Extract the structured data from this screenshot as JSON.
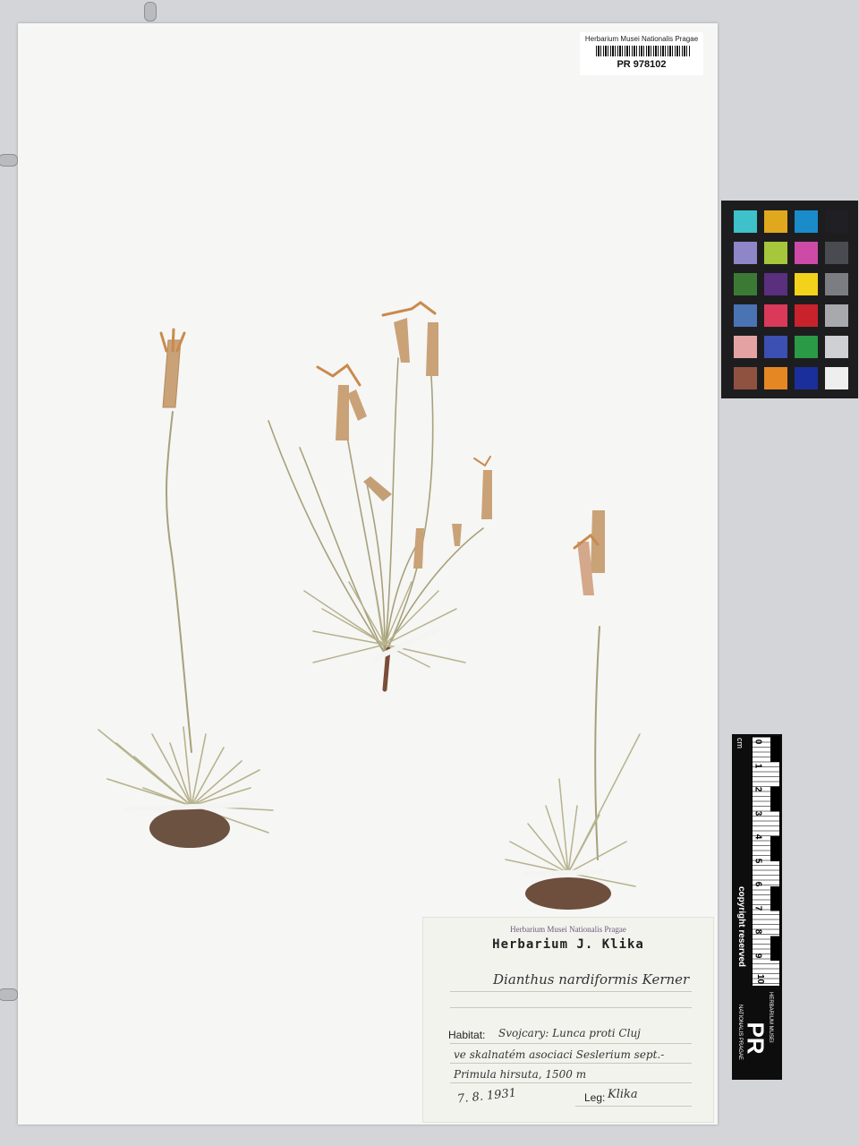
{
  "barcode": {
    "institution": "Herbarium Musei Nationalis Pragae",
    "id": "PR 978102"
  },
  "scale": {
    "unit": "cm",
    "numbers": [
      "0",
      "1",
      "2",
      "3",
      "4",
      "5",
      "6",
      "7",
      "8",
      "9",
      "10"
    ],
    "copyright": "copyright reserved",
    "logo_text": "PR",
    "logo_caption_top": "HERBARIUM MUSEI",
    "logo_caption_bottom": "NATIONALIS PRAGAE"
  },
  "color_chart": {
    "rows": [
      [
        "#3ec1c9",
        "#e0a81d",
        "#1a8cc9",
        "#202024"
      ],
      [
        "#8d86c9",
        "#a6c63b",
        "#cd4aa6",
        "#4a4b50"
      ],
      [
        "#3b7a35",
        "#5a2f7d",
        "#f2d21a",
        "#7c7d82"
      ],
      [
        "#4a73b4",
        "#d93a5a",
        "#c8232c",
        "#a8a9ad"
      ],
      [
        "#e4a3a2",
        "#3c4fb2",
        "#2a9a46",
        "#cfd0d3"
      ],
      [
        "#8f5240",
        "#e58722",
        "#1a2f9b",
        "#eeeeee"
      ]
    ]
  },
  "label": {
    "stamp": "Herbarium Musei Nationalis Pragae",
    "title": "Herbarium J. Klika",
    "taxon": "Dianthus nardiformis Kerner",
    "habitat_label": "Habitat:",
    "habitat_line1": "Svojcary: Lunca proti Cluj",
    "habitat_line2": "ve skalnatém asociaci Seslerium sept.-",
    "habitat_line3": "Primula hirsuta, 1500 m",
    "date": "7. 8. 1931",
    "leg_label": "Leg:",
    "leg_value": "Klika"
  }
}
